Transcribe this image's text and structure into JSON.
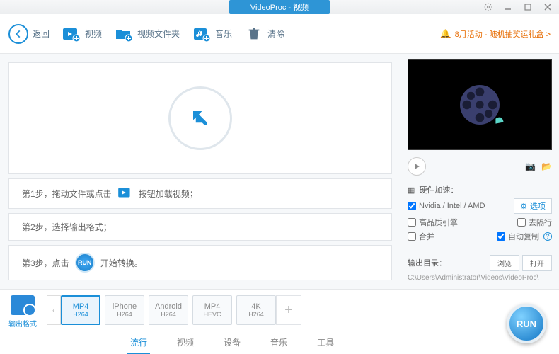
{
  "titlebar": {
    "title": "VideoProc - 视频"
  },
  "toolbar": {
    "back": "返回",
    "video": "视频",
    "video_folder": "视频文件夹",
    "music": "音乐",
    "clear": "清除"
  },
  "promo": {
    "icon_name": "bell-icon",
    "text": "8月活动 - 随机抽奖运礼盒 >"
  },
  "steps": {
    "s1a": "第1步，拖动文件或点击",
    "s1b": "按钮加载视频；",
    "s2": "第2步，选择输出格式；",
    "s3a": "第3步，点击",
    "s3b": "开始转换。",
    "run_pill": "RUN"
  },
  "right": {
    "hw_title": "硬件加速：",
    "hw_main": "Nvidia / Intel / AMD",
    "opt_btn": "选项",
    "chk_hq": "高品质引擎",
    "chk_deint": "去隔行",
    "chk_merge": "合并",
    "chk_autocopy": "自动复制",
    "outdir_label": "输出目录：",
    "browse": "浏览",
    "open": "打开",
    "path": "C:\\Users\\Administrator\\Videos\\VideoProc\\"
  },
  "bottom": {
    "out_fmt_label": "输出格式",
    "formats": [
      {
        "top": "MP4",
        "bot": "H264",
        "sel": true
      },
      {
        "top": "iPhone",
        "bot": "H264",
        "sel": false
      },
      {
        "top": "Android",
        "bot": "H264",
        "sel": false
      },
      {
        "top": "MP4",
        "bot": "HEVC",
        "sel": false
      },
      {
        "top": "4K",
        "bot": "H264",
        "sel": false
      }
    ],
    "tabs": [
      "流行",
      "视频",
      "设备",
      "音乐",
      "工具"
    ],
    "tab_selected": 0,
    "run": "RUN"
  }
}
